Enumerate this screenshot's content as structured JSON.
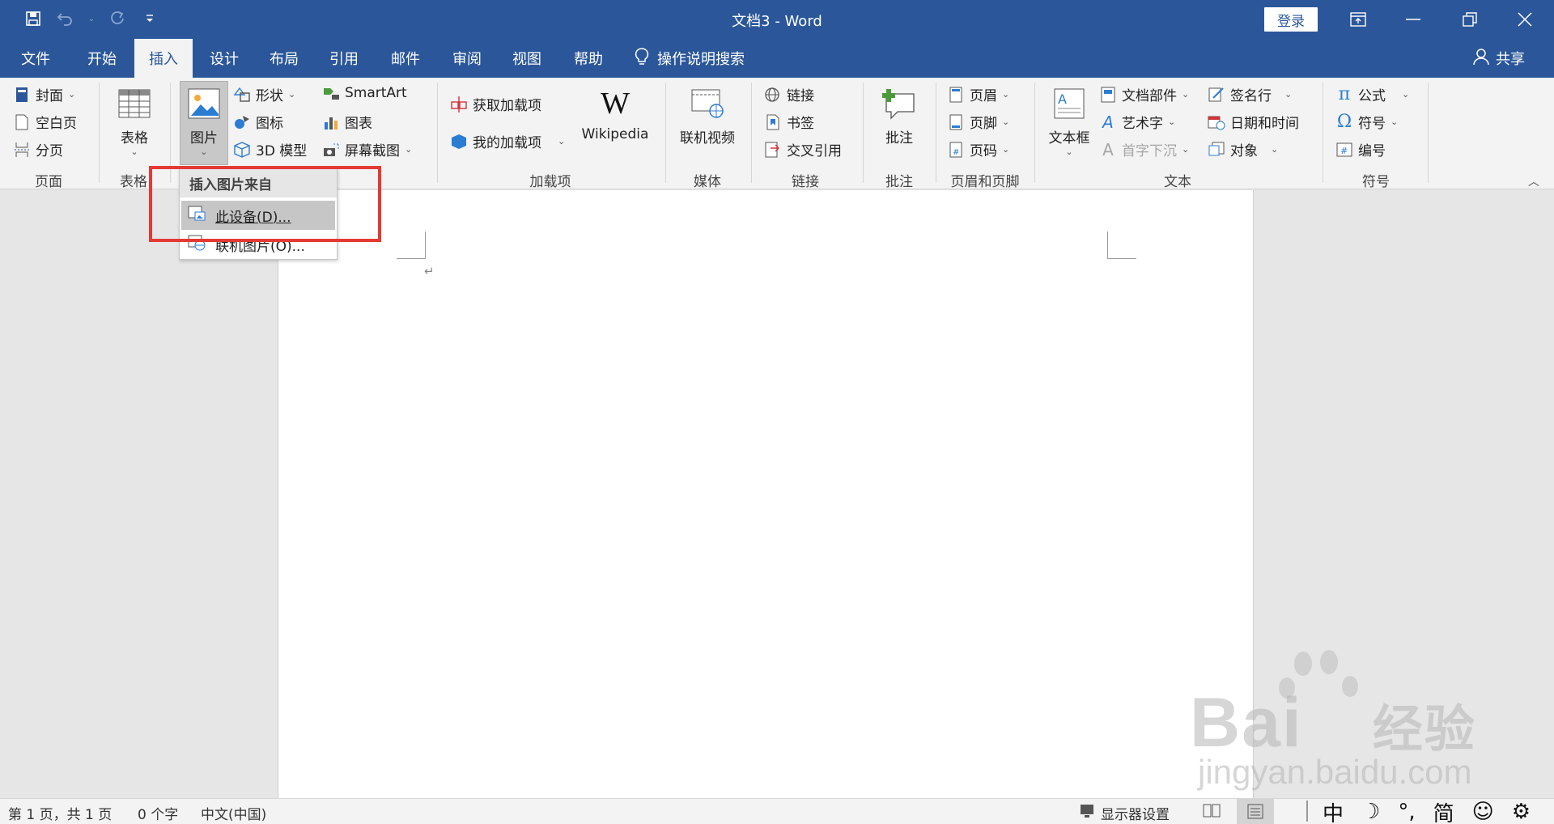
{
  "window": {
    "title": "文档3  -  Word",
    "login_label": "登录"
  },
  "tabs": [
    {
      "label": "文件"
    },
    {
      "label": "开始"
    },
    {
      "label": "插入"
    },
    {
      "label": "设计"
    },
    {
      "label": "布局"
    },
    {
      "label": "引用"
    },
    {
      "label": "邮件"
    },
    {
      "label": "审阅"
    },
    {
      "label": "视图"
    },
    {
      "label": "帮助"
    }
  ],
  "active_tab": "插入",
  "tell_me": "操作说明搜索",
  "share": "共享",
  "ribbon": {
    "pages": {
      "cover": "封面",
      "blank": "空白页",
      "break": "分页",
      "group": "页面"
    },
    "tables": {
      "table": "表格",
      "group": "表格"
    },
    "illustrations": {
      "pictures": "图片",
      "shapes": "形状",
      "icons": "图标",
      "model3d": "3D 模型",
      "smartart": "SmartArt",
      "chart": "图表",
      "screenshot": "屏幕截图"
    },
    "addins": {
      "get": "获取加载项",
      "mine": "我的加载项",
      "wikipedia": "Wikipedia",
      "group": "加载项"
    },
    "media": {
      "video": "联机视频",
      "group": "媒体"
    },
    "links": {
      "link": "链接",
      "bookmark": "书签",
      "crossref": "交叉引用",
      "group": "链接"
    },
    "comments": {
      "comment": "批注",
      "group": "批注"
    },
    "headerfooter": {
      "header": "页眉",
      "footer": "页脚",
      "pagenum": "页码",
      "group": "页眉和页脚"
    },
    "text": {
      "textbox": "文本框",
      "quickparts": "文档部件",
      "wordart": "艺术字",
      "dropcap": "首字下沉",
      "signature": "签名行",
      "datetime": "日期和时间",
      "object": "对象",
      "group": "文本"
    },
    "symbols": {
      "equation": "公式",
      "symbol": "符号",
      "number": "编号",
      "group": "符号"
    }
  },
  "dropdown": {
    "header": "插入图片来自",
    "items": [
      {
        "label": "此设备(D)..."
      },
      {
        "label": "联机图片(O)..."
      }
    ]
  },
  "status": {
    "page": "第 1 页，共 1 页",
    "words": "0 个字",
    "lang": "中文(中国)",
    "display": "显示器设置",
    "ime": [
      "中",
      "☽",
      "°,",
      "简",
      "☺",
      "⚙"
    ]
  },
  "watermark": {
    "brand": "Bai",
    "brand2": "经验",
    "url": "jingyan.baidu.com"
  },
  "colors": {
    "title_bar": "#2b579a",
    "ribbon": "#f3f3f3",
    "highlight_box": "#e53935"
  }
}
